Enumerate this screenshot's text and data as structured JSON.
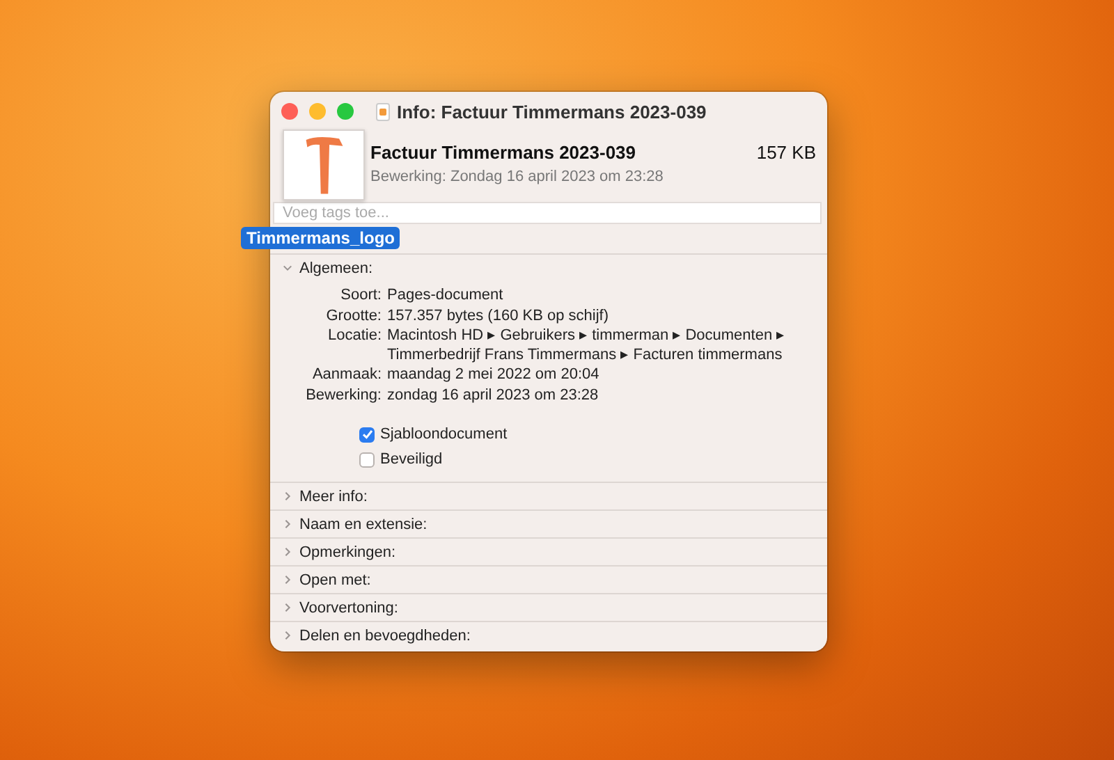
{
  "window": {
    "title": "Info: Factuur Timmermans 2023-039"
  },
  "header": {
    "name": "Factuur Timmermans 2023-039",
    "size": "157 KB",
    "modified": "Bewerking: Zondag 16 april 2023 om 23:28"
  },
  "tags": {
    "placeholder": "Voeg tags toe..."
  },
  "drag_item": {
    "label": "Timmermans_logo"
  },
  "sections": [
    {
      "label": "Algemeen:",
      "expanded": true,
      "rows": [
        {
          "label": "Soort:",
          "value": "Pages-document"
        },
        {
          "label": "Grootte:",
          "value": "157.357 bytes (160 KB op schijf)"
        },
        {
          "label": "Locatie:",
          "value": "Macintosh HD ▸ Gebruikers ▸ timmerman ▸ Documenten ▸ Timmerbedrijf Frans Timmermans ▸ Facturen timmermans"
        },
        {
          "label": "Aanmaak:",
          "value": "maandag 2 mei 2022 om 20:04"
        },
        {
          "label": "Bewerking:",
          "value": "zondag 16 april 2023 om 23:28"
        }
      ],
      "checkboxes": [
        {
          "label": "Sjabloondocument",
          "checked": true
        },
        {
          "label": "Beveiligd",
          "checked": false
        }
      ]
    },
    {
      "label": "Meer info:",
      "expanded": false
    },
    {
      "label": "Naam en extensie:",
      "expanded": false
    },
    {
      "label": "Opmerkingen:",
      "expanded": false
    },
    {
      "label": "Open met:",
      "expanded": false
    },
    {
      "label": "Voorvertoning:",
      "expanded": false
    },
    {
      "label": "Delen en bevoegdheden:",
      "expanded": false
    }
  ]
}
